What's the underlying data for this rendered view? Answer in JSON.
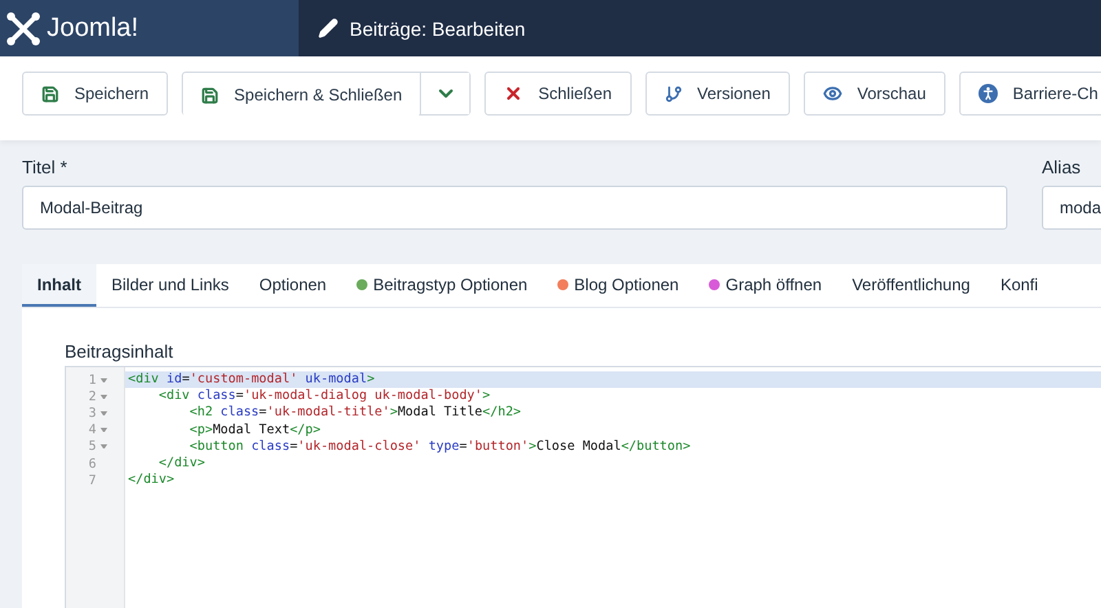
{
  "header": {
    "logo": "Joomla!",
    "title": "Beiträge: Bearbeiten"
  },
  "toolbar": [
    {
      "label": "Speichern",
      "kind": "save"
    },
    {
      "label": "Speichern & Schließen",
      "kind": "save",
      "dropdown": true
    },
    {
      "label": "Schließen",
      "kind": "close"
    },
    {
      "label": "Versionen",
      "kind": "branch"
    },
    {
      "label": "Vorschau",
      "kind": "eye"
    },
    {
      "label": "Barriere-Ch",
      "kind": "access"
    }
  ],
  "title_field": {
    "label": "Titel *",
    "value": "Modal-Beitrag"
  },
  "alias_field": {
    "label": "Alias",
    "value": "moda"
  },
  "tabs": [
    {
      "label": "Inhalt",
      "selected": true
    },
    {
      "label": "Bilder und Links",
      "selected": false
    },
    {
      "label": "Optionen",
      "selected": false
    },
    {
      "label": "Beitragstyp Optionen",
      "selected": false,
      "color": "#6aab5c"
    },
    {
      "label": "Blog Optionen",
      "selected": false,
      "color": "#f27e5b"
    },
    {
      "label": "Graph öffnen",
      "selected": false,
      "color": "#d85ad8"
    },
    {
      "label": "Veröffentlichung",
      "selected": false
    },
    {
      "label": "Konfi",
      "selected": false
    }
  ],
  "editor": {
    "label": "Beitragsinhalt",
    "lines": [
      {
        "number": "1",
        "foldable": true,
        "active": true,
        "tokens": [
          {
            "kind": "tag",
            "text": "<div "
          },
          {
            "kind": "attr",
            "text": "id"
          },
          {
            "kind": "plain",
            "text": "="
          },
          {
            "kind": "string",
            "text": "'custom-modal'"
          },
          {
            "kind": "attr",
            "text": " uk-modal"
          },
          {
            "kind": "tag",
            "text": ">"
          }
        ]
      },
      {
        "number": "2",
        "foldable": true,
        "active": false,
        "tokens": [
          {
            "kind": "tag",
            "text": "    <div "
          },
          {
            "kind": "attr",
            "text": "class"
          },
          {
            "kind": "plain",
            "text": "="
          },
          {
            "kind": "string",
            "text": "'uk-modal-dialog uk-modal-body'"
          },
          {
            "kind": "tag",
            "text": ">"
          }
        ]
      },
      {
        "number": "3",
        "foldable": true,
        "active": false,
        "tokens": [
          {
            "kind": "tag",
            "text": "        <h2 "
          },
          {
            "kind": "attr",
            "text": "class"
          },
          {
            "kind": "plain",
            "text": "="
          },
          {
            "kind": "string",
            "text": "'uk-modal-title'"
          },
          {
            "kind": "tag",
            "text": ">"
          },
          {
            "kind": "plain",
            "text": "Modal Title"
          },
          {
            "kind": "tag",
            "text": "</h2>"
          }
        ]
      },
      {
        "number": "4",
        "foldable": true,
        "active": false,
        "tokens": [
          {
            "kind": "tag",
            "text": "        <p>"
          },
          {
            "kind": "plain",
            "text": "Modal Text"
          },
          {
            "kind": "tag",
            "text": "</p>"
          }
        ]
      },
      {
        "number": "5",
        "foldable": true,
        "active": false,
        "tokens": [
          {
            "kind": "tag",
            "text": "        <button "
          },
          {
            "kind": "attr",
            "text": "class"
          },
          {
            "kind": "plain",
            "text": "="
          },
          {
            "kind": "string",
            "text": "'uk-modal-close'"
          },
          {
            "kind": "attr",
            "text": " type"
          },
          {
            "kind": "plain",
            "text": "="
          },
          {
            "kind": "string",
            "text": "'button'"
          },
          {
            "kind": "tag",
            "text": ">"
          },
          {
            "kind": "plain",
            "text": "Close Modal"
          },
          {
            "kind": "tag",
            "text": "</button>"
          }
        ]
      },
      {
        "number": "6",
        "foldable": false,
        "active": false,
        "tokens": [
          {
            "kind": "tag",
            "text": "    </div>"
          }
        ]
      },
      {
        "number": "7",
        "foldable": false,
        "active": false,
        "tokens": [
          {
            "kind": "tag",
            "text": "</div>"
          }
        ]
      }
    ]
  }
}
